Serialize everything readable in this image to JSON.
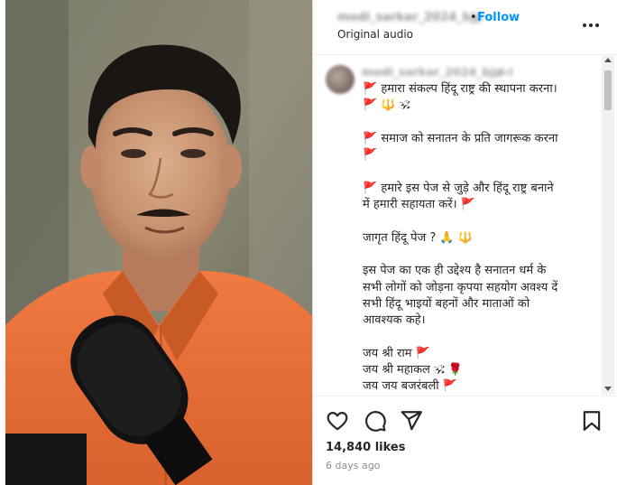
{
  "header": {
    "username": "modi_sarkar_2024_bjp",
    "separator": "•",
    "follow_label": "Follow",
    "audio_label": "Original audio"
  },
  "caption": {
    "username": "modi_sarkar_2024_bjp",
    "time": "6d",
    "lines": [
      "🚩 हमारा संकल्प हिंदू राष्ट्र की स्थापना करना।",
      "🚩 🔱 🕉",
      "",
      "🚩 समाज को सनातन के प्रति जागरूक करना",
      "🚩",
      "",
      "🚩 हमारे इस पेज से जुड़े और हिंदू राष्ट्र बनाने",
      "में हमारी सहायता करें। 🚩",
      "",
      "जागृत हिंदू पेज ? 🙏 🔱",
      "",
      "इस पेज का एक ही उद्देश्य है सनातन धर्म के",
      "सभी लोगों को जोड़ना कृपया सहयोग अवश्य दें",
      "सभी हिंदू भाइयों बहनों और माताओं को",
      "आवश्यक कहे।",
      "",
      "जय श्री राम 🚩",
      "जय श्री महाकल 🕉 🌹",
      "जय जय बजरंबली 🚩"
    ]
  },
  "footer": {
    "likes": "14,840 likes",
    "posted": "6 days ago"
  },
  "icons": {
    "like": "heart-icon",
    "comment": "comment-icon",
    "share": "share-icon",
    "save": "bookmark-icon",
    "more": "more-options-icon"
  },
  "colors": {
    "follow": "#0095f6",
    "shirt": "#e8703a",
    "text": "#262626",
    "muted": "#8e8e8e"
  }
}
